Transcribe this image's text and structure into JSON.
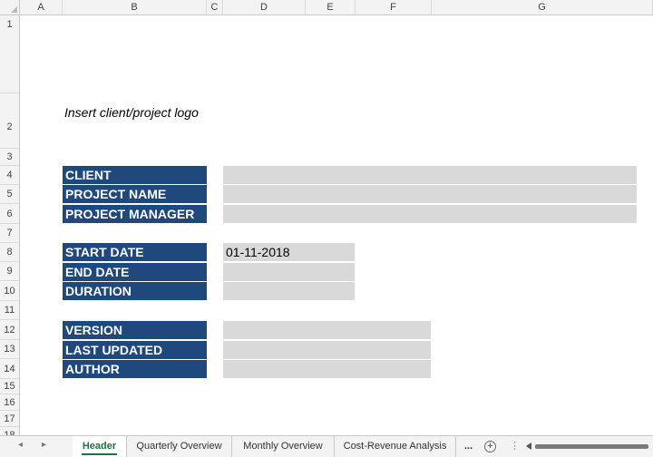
{
  "columns": [
    "A",
    "B",
    "C",
    "D",
    "E",
    "F",
    "G"
  ],
  "rows": [
    "1",
    "2",
    "3",
    "4",
    "5",
    "6",
    "7",
    "8",
    "9",
    "10",
    "11",
    "12",
    "13",
    "14",
    "15",
    "16",
    "17",
    "18"
  ],
  "logo_placeholder": "Insert client/project logo",
  "labels": {
    "client": "CLIENT",
    "project_name": "PROJECT NAME",
    "project_manager": "PROJECT MANAGER",
    "start_date": "START DATE",
    "end_date": "END DATE",
    "duration": "DURATION",
    "version": "VERSION",
    "last_updated": "LAST UPDATED",
    "author": "AUTHOR"
  },
  "values": {
    "client": "",
    "project_name": "",
    "project_manager": "",
    "start_date": "01-11-2018",
    "end_date": "",
    "duration": "",
    "version": "",
    "last_updated": "",
    "author": ""
  },
  "tabs": [
    "Header",
    "Quarterly Overview",
    "Monthly Overview",
    "Cost-Revenue Analysis"
  ],
  "tabbar": {
    "more": "...",
    "add": "+",
    "kebab": "⋮",
    "nav_prev": "◂",
    "nav_next": "▸"
  },
  "colors": {
    "label_bg": "#1f497d",
    "field_bg": "#d9d9d9",
    "active_tab": "#1e7145"
  }
}
